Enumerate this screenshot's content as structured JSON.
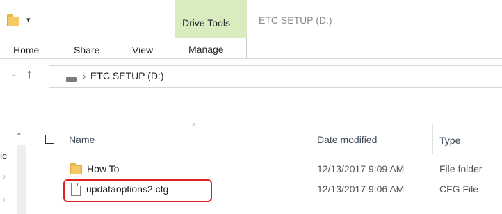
{
  "titlebar": {
    "quick_access_dropdown": "▾",
    "context_tab_label": "Drive Tools",
    "window_title": "ETC SETUP (D:)"
  },
  "ribbon": {
    "tabs": [
      {
        "label": "Home"
      },
      {
        "label": "Share"
      },
      {
        "label": "View"
      },
      {
        "label": "Manage"
      }
    ]
  },
  "address_bar": {
    "back_chevron": "⌄",
    "up_arrow": "↑",
    "separator": "›",
    "location": "ETC SETUP (D:)"
  },
  "nav_pane": {
    "scroll_up": "^",
    "truncated_label": "ic",
    "pin_glyph": "ˀ"
  },
  "columns": {
    "name": "Name",
    "sort_caret": "^",
    "date_modified": "Date modified",
    "type": "Type"
  },
  "files": [
    {
      "name": "How To",
      "date_modified": "12/13/2017 9:09 AM",
      "type": "File folder",
      "icon": "folder-icon"
    },
    {
      "name": "updataoptions2.cfg",
      "date_modified": "12/13/2017 9:06 AM",
      "type": "CFG File",
      "icon": "file-icon",
      "highlighted": true
    }
  ],
  "colors": {
    "drive_tools_bg": "#d9ecbf",
    "highlight": "#e02020",
    "folder": "#f4cc63"
  }
}
